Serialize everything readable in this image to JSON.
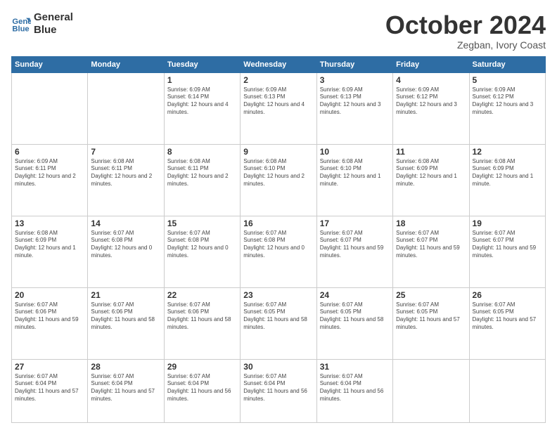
{
  "header": {
    "logo": {
      "line1": "General",
      "line2": "Blue"
    },
    "title": "October 2024",
    "subtitle": "Zegban, Ivory Coast"
  },
  "weekdays": [
    "Sunday",
    "Monday",
    "Tuesday",
    "Wednesday",
    "Thursday",
    "Friday",
    "Saturday"
  ],
  "weeks": [
    [
      {
        "day": "",
        "info": ""
      },
      {
        "day": "",
        "info": ""
      },
      {
        "day": "1",
        "info": "Sunrise: 6:09 AM\nSunset: 6:14 PM\nDaylight: 12 hours and 4 minutes."
      },
      {
        "day": "2",
        "info": "Sunrise: 6:09 AM\nSunset: 6:13 PM\nDaylight: 12 hours and 4 minutes."
      },
      {
        "day": "3",
        "info": "Sunrise: 6:09 AM\nSunset: 6:13 PM\nDaylight: 12 hours and 3 minutes."
      },
      {
        "day": "4",
        "info": "Sunrise: 6:09 AM\nSunset: 6:12 PM\nDaylight: 12 hours and 3 minutes."
      },
      {
        "day": "5",
        "info": "Sunrise: 6:09 AM\nSunset: 6:12 PM\nDaylight: 12 hours and 3 minutes."
      }
    ],
    [
      {
        "day": "6",
        "info": "Sunrise: 6:09 AM\nSunset: 6:11 PM\nDaylight: 12 hours and 2 minutes."
      },
      {
        "day": "7",
        "info": "Sunrise: 6:08 AM\nSunset: 6:11 PM\nDaylight: 12 hours and 2 minutes."
      },
      {
        "day": "8",
        "info": "Sunrise: 6:08 AM\nSunset: 6:11 PM\nDaylight: 12 hours and 2 minutes."
      },
      {
        "day": "9",
        "info": "Sunrise: 6:08 AM\nSunset: 6:10 PM\nDaylight: 12 hours and 2 minutes."
      },
      {
        "day": "10",
        "info": "Sunrise: 6:08 AM\nSunset: 6:10 PM\nDaylight: 12 hours and 1 minute."
      },
      {
        "day": "11",
        "info": "Sunrise: 6:08 AM\nSunset: 6:09 PM\nDaylight: 12 hours and 1 minute."
      },
      {
        "day": "12",
        "info": "Sunrise: 6:08 AM\nSunset: 6:09 PM\nDaylight: 12 hours and 1 minute."
      }
    ],
    [
      {
        "day": "13",
        "info": "Sunrise: 6:08 AM\nSunset: 6:09 PM\nDaylight: 12 hours and 1 minute."
      },
      {
        "day": "14",
        "info": "Sunrise: 6:07 AM\nSunset: 6:08 PM\nDaylight: 12 hours and 0 minutes."
      },
      {
        "day": "15",
        "info": "Sunrise: 6:07 AM\nSunset: 6:08 PM\nDaylight: 12 hours and 0 minutes."
      },
      {
        "day": "16",
        "info": "Sunrise: 6:07 AM\nSunset: 6:08 PM\nDaylight: 12 hours and 0 minutes."
      },
      {
        "day": "17",
        "info": "Sunrise: 6:07 AM\nSunset: 6:07 PM\nDaylight: 11 hours and 59 minutes."
      },
      {
        "day": "18",
        "info": "Sunrise: 6:07 AM\nSunset: 6:07 PM\nDaylight: 11 hours and 59 minutes."
      },
      {
        "day": "19",
        "info": "Sunrise: 6:07 AM\nSunset: 6:07 PM\nDaylight: 11 hours and 59 minutes."
      }
    ],
    [
      {
        "day": "20",
        "info": "Sunrise: 6:07 AM\nSunset: 6:06 PM\nDaylight: 11 hours and 59 minutes."
      },
      {
        "day": "21",
        "info": "Sunrise: 6:07 AM\nSunset: 6:06 PM\nDaylight: 11 hours and 58 minutes."
      },
      {
        "day": "22",
        "info": "Sunrise: 6:07 AM\nSunset: 6:06 PM\nDaylight: 11 hours and 58 minutes."
      },
      {
        "day": "23",
        "info": "Sunrise: 6:07 AM\nSunset: 6:05 PM\nDaylight: 11 hours and 58 minutes."
      },
      {
        "day": "24",
        "info": "Sunrise: 6:07 AM\nSunset: 6:05 PM\nDaylight: 11 hours and 58 minutes."
      },
      {
        "day": "25",
        "info": "Sunrise: 6:07 AM\nSunset: 6:05 PM\nDaylight: 11 hours and 57 minutes."
      },
      {
        "day": "26",
        "info": "Sunrise: 6:07 AM\nSunset: 6:05 PM\nDaylight: 11 hours and 57 minutes."
      }
    ],
    [
      {
        "day": "27",
        "info": "Sunrise: 6:07 AM\nSunset: 6:04 PM\nDaylight: 11 hours and 57 minutes."
      },
      {
        "day": "28",
        "info": "Sunrise: 6:07 AM\nSunset: 6:04 PM\nDaylight: 11 hours and 57 minutes."
      },
      {
        "day": "29",
        "info": "Sunrise: 6:07 AM\nSunset: 6:04 PM\nDaylight: 11 hours and 56 minutes."
      },
      {
        "day": "30",
        "info": "Sunrise: 6:07 AM\nSunset: 6:04 PM\nDaylight: 11 hours and 56 minutes."
      },
      {
        "day": "31",
        "info": "Sunrise: 6:07 AM\nSunset: 6:04 PM\nDaylight: 11 hours and 56 minutes."
      },
      {
        "day": "",
        "info": ""
      },
      {
        "day": "",
        "info": ""
      }
    ]
  ]
}
